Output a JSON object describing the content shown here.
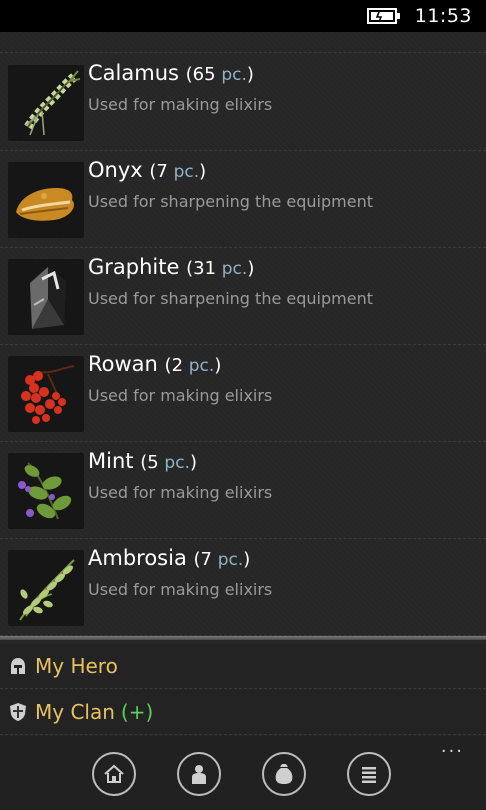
{
  "status_bar": {
    "time": "11:53"
  },
  "items": [
    {
      "name": "Calamus",
      "count": "65",
      "unit": "pc.",
      "description": "Used for making elixirs",
      "icon": "calamus-icon"
    },
    {
      "name": "Onyx",
      "count": "7",
      "unit": "pc.",
      "description": "Used for sharpening the equipment",
      "icon": "onyx-icon"
    },
    {
      "name": "Graphite",
      "count": "31",
      "unit": "pc.",
      "description": "Used for sharpening the equipment",
      "icon": "graphite-icon"
    },
    {
      "name": "Rowan",
      "count": "2",
      "unit": "pc.",
      "description": "Used for making elixirs",
      "icon": "rowan-icon"
    },
    {
      "name": "Mint",
      "count": "5",
      "unit": "pc.",
      "description": "Used for making elixirs",
      "icon": "mint-icon"
    },
    {
      "name": "Ambrosia",
      "count": "7",
      "unit": "pc.",
      "description": "Used for making elixirs",
      "icon": "ambrosia-icon"
    }
  ],
  "menu": {
    "my_hero": "My Hero",
    "my_clan": "My Clan",
    "my_clan_badge": "(+)"
  },
  "app_bar": {
    "buttons": [
      "home-icon",
      "person-icon",
      "bag-icon",
      "list-icon"
    ],
    "more": "..."
  },
  "colors": {
    "background": "#262626",
    "accent_gold": "#e8c25e",
    "accent_green": "#5ad05a",
    "unit_blue": "#8fb3c9",
    "description_gray": "#9a9a9a"
  }
}
